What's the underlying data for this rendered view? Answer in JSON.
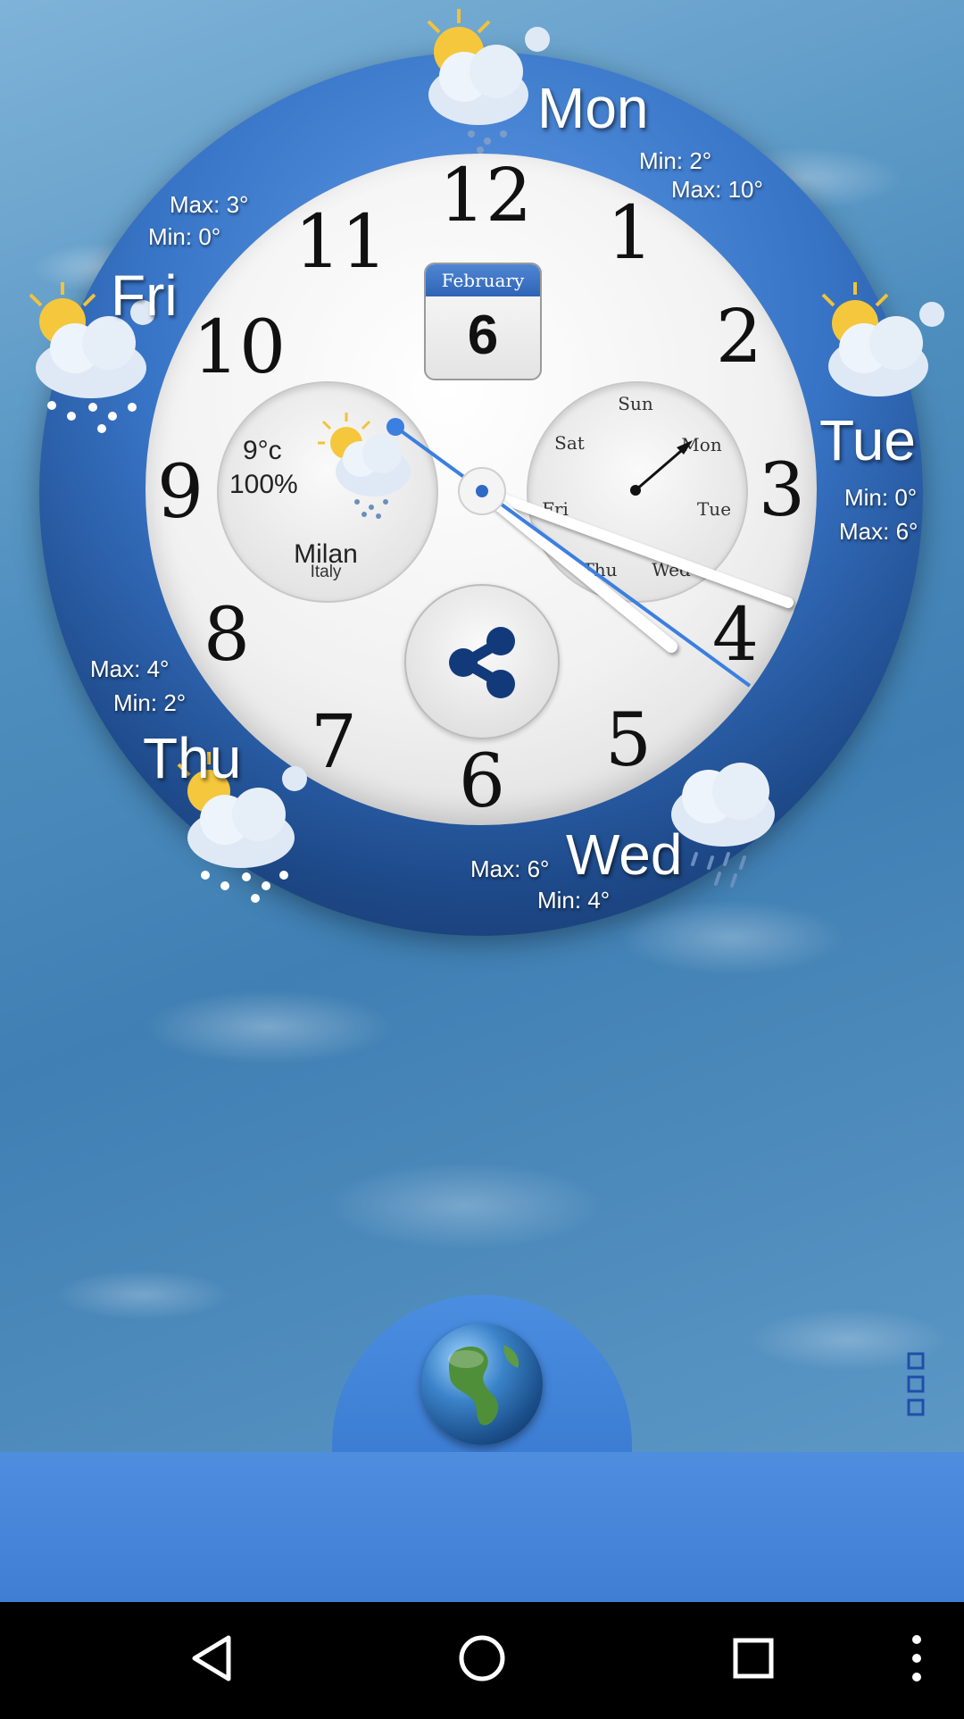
{
  "calendar": {
    "month": "February",
    "day": "6"
  },
  "clock": {
    "numerals": [
      "12",
      "1",
      "2",
      "3",
      "4",
      "5",
      "6",
      "7",
      "8",
      "9",
      "10",
      "11"
    ]
  },
  "weather_dial": {
    "temperature": "9°c",
    "humidity": "100%",
    "city": "Milan",
    "country": "Italy"
  },
  "day_dial": {
    "days": [
      "Sun",
      "Mon",
      "Tue",
      "Wed",
      "Thu",
      "Fri",
      "Sat"
    ]
  },
  "forecast": {
    "mon": {
      "day": "Mon",
      "min": "Min: 2°",
      "max": "Max: 10°"
    },
    "tue": {
      "day": "Tue",
      "min": "Min: 0°",
      "max": "Max: 6°"
    },
    "wed": {
      "day": "Wed",
      "min": "Min: 4°",
      "max": "Max: 6°"
    },
    "thu": {
      "day": "Thu",
      "min": "Min: 2°",
      "max": "Max: 4°"
    },
    "fri": {
      "day": "Fri",
      "min": "Min: 0°",
      "max": "Max: 3°"
    }
  },
  "icons": {
    "share": "share-icon",
    "globe": "globe-icon",
    "menu": "menu-icon",
    "nav_back": "back-icon",
    "nav_home": "home-icon",
    "nav_recents": "recents-icon",
    "nav_more": "more-icon"
  },
  "colors": {
    "ring": "#3874c6",
    "accent_hand": "#3b7fe0",
    "band": "#4f8ddf"
  }
}
